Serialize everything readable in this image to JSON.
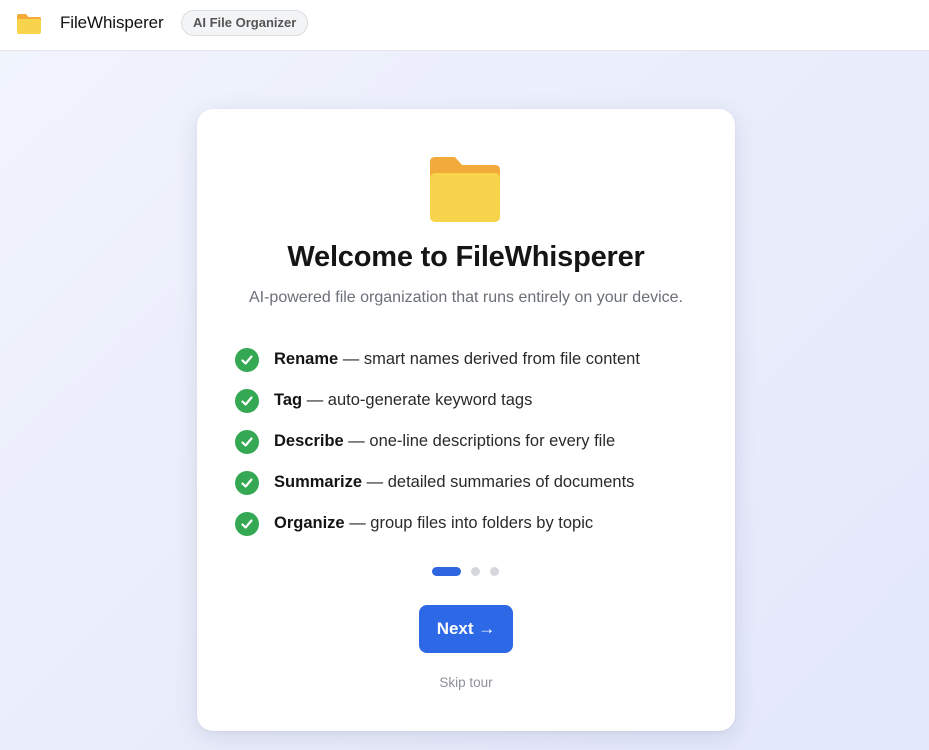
{
  "header": {
    "app_name": "FileWhisperer",
    "badge": "AI File Organizer",
    "icon": "folder-icon"
  },
  "onboarding": {
    "hero_icon": "folder-icon",
    "title": "Welcome to FileWhisperer",
    "subtitle": "AI-powered file organization that runs entirely on your device.",
    "features": [
      {
        "name": "Rename",
        "description": " — smart names derived from file content"
      },
      {
        "name": "Tag",
        "description": " — auto-generate keyword tags"
      },
      {
        "name": "Describe",
        "description": " — one-line descriptions for every file"
      },
      {
        "name": "Summarize",
        "description": " — detailed summaries of documents"
      },
      {
        "name": "Organize",
        "description": " — group files into folders by topic"
      }
    ],
    "step_current": 1,
    "step_total": 3,
    "next_label": "Next →",
    "skip_label": "Skip tour"
  },
  "colors": {
    "accent": "#2d68e6",
    "check": "#34a853",
    "folder_front": "#f7d44c",
    "folder_back": "#f2ab3a"
  }
}
